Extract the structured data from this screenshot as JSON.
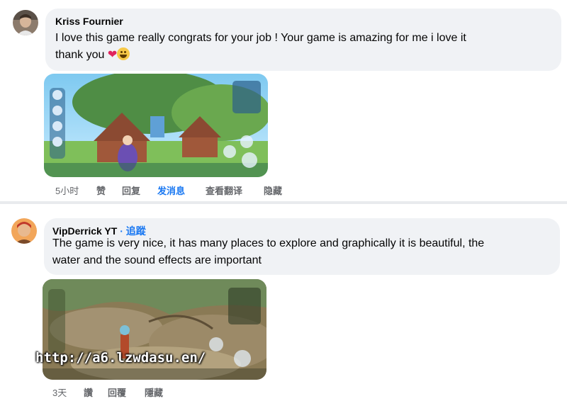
{
  "comments": [
    {
      "author": "Kriss Fournier",
      "text_line1": "I love this game really congrats for your job ! Your game is amazing for me i love it",
      "text_line2": "thank you",
      "heart": "❤️",
      "actions": {
        "time": "5小时",
        "like": "赞",
        "reply": "回复",
        "message": "发消息",
        "translate": "查看翻译",
        "hide": "隐藏"
      }
    },
    {
      "author": "VipDerrick YT",
      "follow": "· 追蹤",
      "text_line1": "The game is very nice, it has many places to explore and graphically it is beautiful, the",
      "text_line2": "water and the sound effects are important",
      "actions": {
        "time": "3天",
        "like": "讚",
        "reply": "回覆",
        "hide": "隱藏"
      }
    }
  ],
  "watermark": "http://a6.lzwdasu.en/",
  "colors": {
    "bubble": "#f0f2f5",
    "link": "#1877f2",
    "meta": "#65676b",
    "heart": "#e0245e"
  },
  "icons": [
    "heart-emoji",
    "grin-emoji"
  ]
}
